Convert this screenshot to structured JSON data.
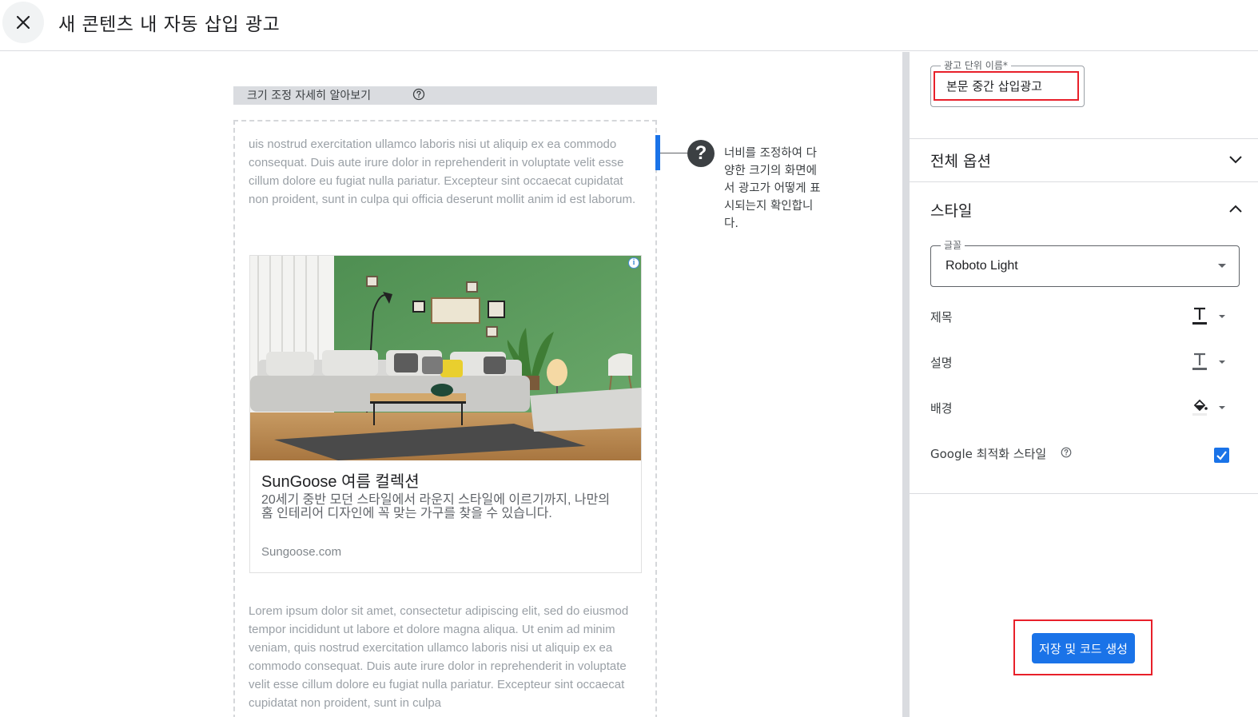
{
  "header": {
    "title": "새 콘텐츠 내 자동 삽입 광고"
  },
  "preview": {
    "resize_label": "크기 조정 자세히 알아보기",
    "hint_text": "너비를 조정하여 다양한 크기의 화면에서 광고가 어떻게 표시되는지 확인합니다.",
    "lorem_top": "uis nostrud exercitation ullamco laboris nisi ut aliquip ex ea commodo consequat. Duis aute irure dolor in reprehenderit in voluptate velit esse cillum dolore eu fugiat nulla pariatur. Excepteur sint occaecat cupidatat non proident, sunt in culpa qui officia deserunt mollit anim id est laborum.",
    "lorem_bottom": "Lorem ipsum dolor sit amet, consectetur adipiscing elit, sed do eiusmod tempor incididunt ut labore et dolore magna aliqua. Ut enim ad minim veniam, quis nostrud exercitation ullamco laboris nisi ut aliquip ex ea commodo consequat. Duis aute irure dolor in reprehenderit in voluptate velit esse cillum dolore eu fugiat nulla pariatur. Excepteur sint occaecat cupidatat non proident, sunt in culpa",
    "ad": {
      "title": "SunGoose 여름 컬렉션",
      "description": "20세기 중반 모던 스타일에서 라운지 스타일에 이르기까지, 나만의 홈 인테리어 디자인에 꼭 맞는 가구를 찾을 수 있습니다.",
      "url": "Sungoose.com",
      "info_glyph": "i"
    }
  },
  "panel": {
    "ad_unit_name_label": "광고 단위 이름*",
    "ad_unit_name_value": "본문 중간 삽입광고",
    "all_options_label": "전체 옵션",
    "style_label": "스타일",
    "font_label": "글꼴",
    "font_value": "Roboto Light",
    "title_label": "제목",
    "description_label": "설명",
    "background_label": "배경",
    "google_optimized_label": "Google 최적화 스타일",
    "save_button_label": "저장 및 코드 생성"
  },
  "colors": {
    "accent": "#1a73e8",
    "highlight": "#e8202a",
    "wall_green": "#5a9a5c"
  }
}
